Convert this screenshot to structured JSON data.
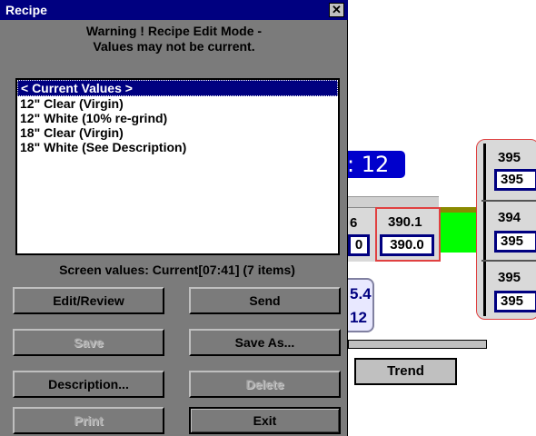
{
  "dialog": {
    "title": "Recipe",
    "close_glyph": "✕",
    "warning_line1": "Warning ! Recipe Edit Mode -",
    "warning_line2": "Values may not be current.",
    "recipes": [
      "< Current Values >",
      "12\" Clear (Virgin)",
      "12\" White (10% re-grind)",
      "18\" Clear (Virgin)",
      "18\" White (See Description)"
    ],
    "screen_values": "Screen values: Current[07:41] (7 items)",
    "buttons": {
      "edit_review": "Edit/Review",
      "send": "Send",
      "save": "Save",
      "save_as": "Save As...",
      "description": "Description...",
      "delete": "Delete",
      "print": "Print",
      "exit": "Exit"
    }
  },
  "background": {
    "badge": ": 12",
    "cell_left_top": "6",
    "cell_left_box": "0",
    "cell_mid_top": "390.1",
    "cell_mid_box": "390.0",
    "partial_top": "5.4",
    "partial_bottom": "12",
    "rack": [
      {
        "value": "395",
        "box": "395"
      },
      {
        "value": "394",
        "box": "395"
      },
      {
        "value": "395",
        "box": "395"
      }
    ],
    "trend": "Trend"
  }
}
